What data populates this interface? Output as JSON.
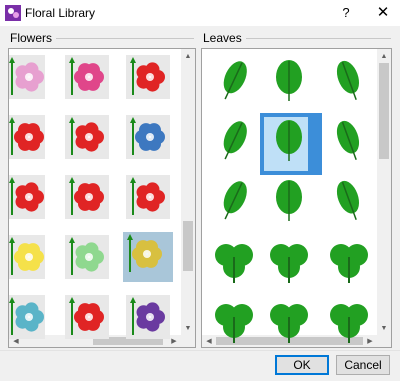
{
  "window": {
    "title": "Floral Library",
    "help_label": "?",
    "close_label": "✕",
    "icon": "app-flower-icon"
  },
  "flowers": {
    "label": "Flowers",
    "items": [
      {
        "name": "pink-daisy-icon",
        "color": "#e7a0d0"
      },
      {
        "name": "pink-hibiscus-icon",
        "color": "#e0468a"
      },
      {
        "name": "red-carnation-icon",
        "color": "#e02424"
      },
      {
        "name": "red-hibiscus-icon",
        "color": "#e02424"
      },
      {
        "name": "red-poppy-icon",
        "color": "#e02424"
      },
      {
        "name": "blue-clematis-icon",
        "color": "#3d78c0"
      },
      {
        "name": "red-camellia-icon",
        "color": "#e02424"
      },
      {
        "name": "red-rose-icon",
        "color": "#e02424"
      },
      {
        "name": "red-ranunculus-icon",
        "color": "#e02424"
      },
      {
        "name": "yellow-dandelion-icon",
        "color": "#f5e14a"
      },
      {
        "name": "green-seedhead-icon",
        "color": "#8fd88f"
      },
      {
        "name": "yellow-periwinkle-icon",
        "color": "#d8c040"
      },
      {
        "name": "teal-ornament-icon",
        "color": "#5ab4c8"
      },
      {
        "name": "red-swirl-flower-icon",
        "color": "#e02424"
      },
      {
        "name": "purple-lily-icon",
        "color": "#6a3aa0"
      }
    ],
    "selected_index": 11
  },
  "leaves": {
    "label": "Leaves",
    "items": [
      {
        "name": "oval-leaf-icon",
        "color": "#22a022"
      },
      {
        "name": "broad-leaf-icon",
        "color": "#22a022"
      },
      {
        "name": "pointed-leaf-icon",
        "color": "#22a022"
      },
      {
        "name": "narrow-leaf-icon",
        "color": "#22a022"
      },
      {
        "name": "lance-leaf-icon",
        "color": "#22a022"
      },
      {
        "name": "curved-leaf-icon",
        "color": "#22a022"
      },
      {
        "name": "lobed-leaf-icon",
        "color": "#22a022"
      },
      {
        "name": "long-leaf-icon",
        "color": "#22a022"
      },
      {
        "name": "palm-leaf-icon",
        "color": "#22a022"
      },
      {
        "name": "heart-leaf-icon",
        "color": "#22a022"
      },
      {
        "name": "ivy-leaf-icon",
        "color": "#22a022"
      },
      {
        "name": "maple-leaf-icon",
        "color": "#22a022"
      },
      {
        "name": "clover-leaf-icon",
        "color": "#22a022"
      },
      {
        "name": "shamrock-leaf-icon",
        "color": "#22a022"
      },
      {
        "name": "trefoil-leaf-icon",
        "color": "#22a022"
      }
    ],
    "selected_index": 4
  },
  "buttons": {
    "ok_label": "OK",
    "cancel_label": "Cancel"
  },
  "colors": {
    "accent": "#0078d7",
    "selection": "#3c8ed9",
    "selection_fill": "#bfe0f7"
  }
}
